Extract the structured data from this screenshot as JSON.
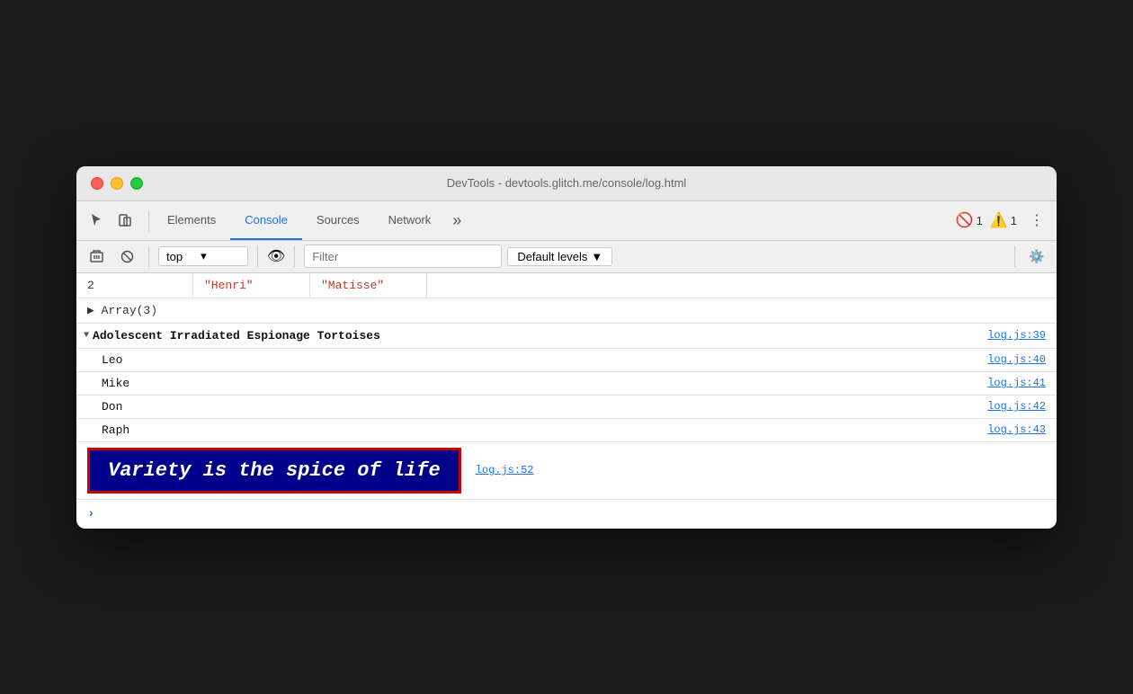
{
  "window": {
    "title": "DevTools - devtools.glitch.me/console/log.html"
  },
  "tabs": [
    {
      "id": "elements",
      "label": "Elements",
      "active": false
    },
    {
      "id": "console",
      "label": "Console",
      "active": true
    },
    {
      "id": "sources",
      "label": "Sources",
      "active": false
    },
    {
      "id": "network",
      "label": "Network",
      "active": false
    }
  ],
  "toolbar": {
    "more_label": "»",
    "error_count": "1",
    "warn_count": "1",
    "more_vert": "⋮"
  },
  "console_toolbar": {
    "context_value": "top",
    "filter_placeholder": "Filter",
    "levels_label": "Default levels",
    "levels_arrow": "▼"
  },
  "console": {
    "table_row": {
      "index": "2",
      "col1": "\"Henri\"",
      "col2": "\"Matisse\""
    },
    "array_label": "▶ Array(3)",
    "group": {
      "label": "Adolescent Irradiated Espionage Tortoises",
      "link": "log.js:39",
      "items": [
        {
          "text": "Leo",
          "link": "log.js:40"
        },
        {
          "text": "Mike",
          "link": "log.js:41"
        },
        {
          "text": "Don",
          "link": "log.js:42"
        },
        {
          "text": "Raph",
          "link": "log.js:43"
        }
      ]
    },
    "styled_log": {
      "text": "Variety is the spice of life",
      "link": "log.js:52"
    }
  }
}
